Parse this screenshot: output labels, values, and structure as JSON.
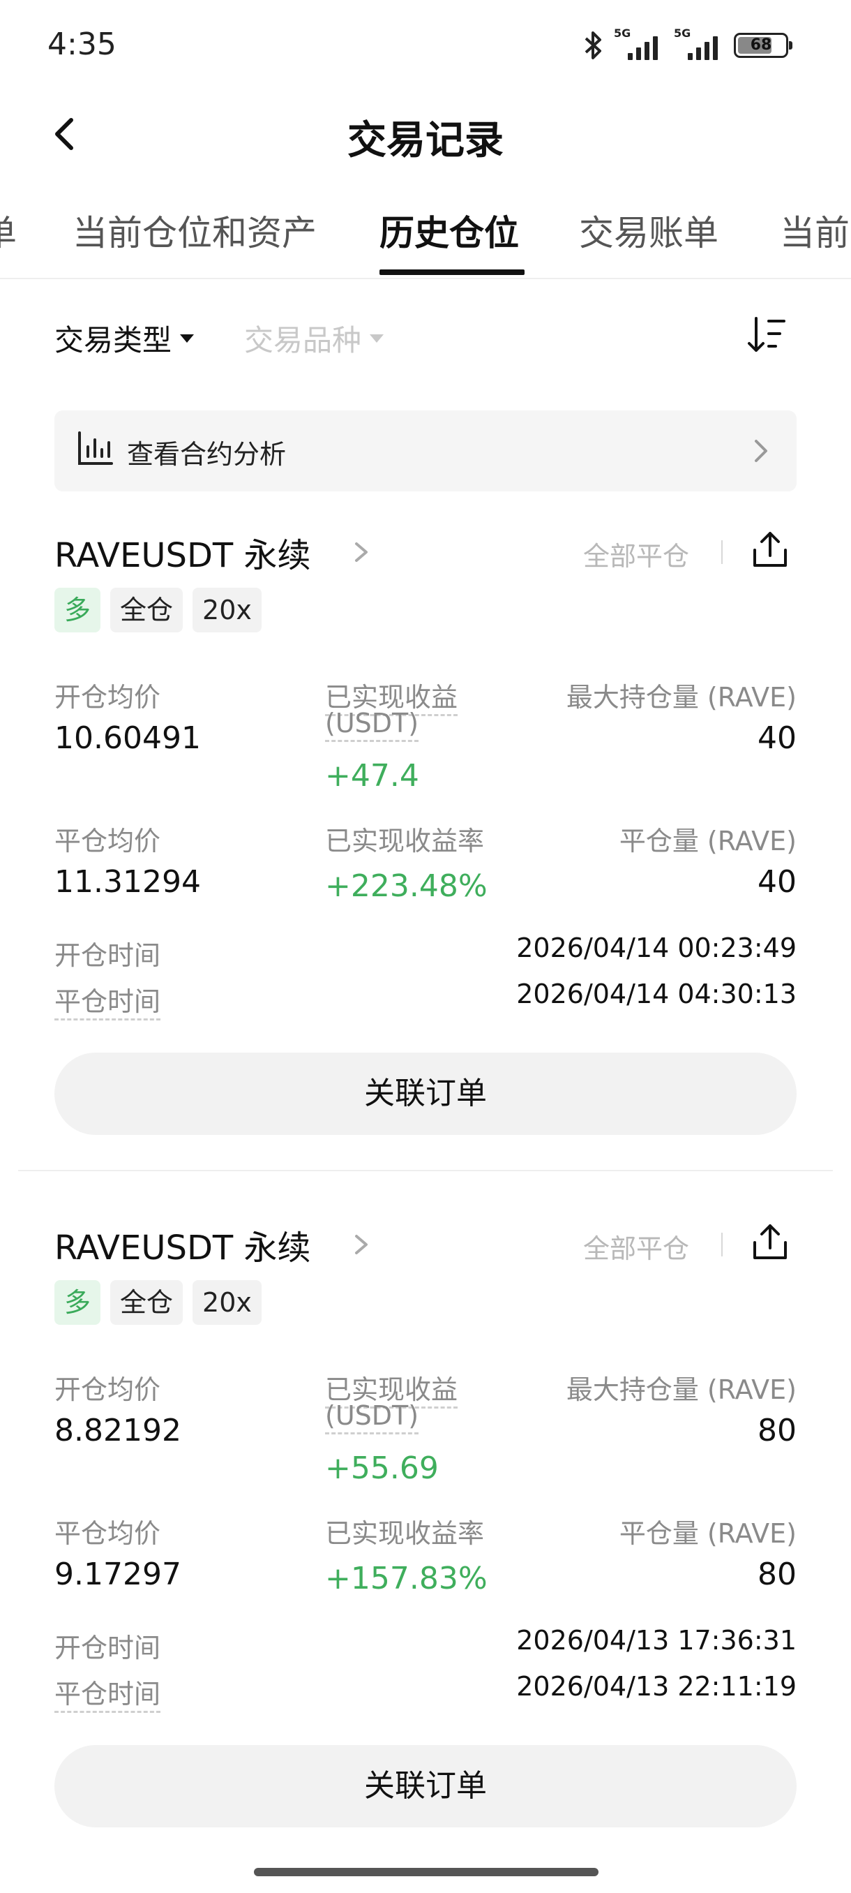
{
  "status": {
    "time": "4:35",
    "network1": "5G",
    "network2": "5G",
    "battery": "68"
  },
  "header": {
    "title": "交易记录"
  },
  "tabs": [
    {
      "label": "单"
    },
    {
      "label": "当前仓位和资产"
    },
    {
      "label": "历史仓位"
    },
    {
      "label": "交易账单"
    },
    {
      "label": "当前"
    }
  ],
  "filters": {
    "trade_type": "交易类型",
    "trade_symbol": "交易品种"
  },
  "analysis": {
    "label": "查看合约分析"
  },
  "labels": {
    "open_avg": "开仓均价",
    "realized_pnl": "已实现收益",
    "realized_pnl_unit": "(USDT)",
    "max_position": "最大持仓量 (RAVE)",
    "close_avg": "平仓均价",
    "realized_rate": "已实现收益率",
    "close_qty": "平仓量 (RAVE)",
    "open_time": "开仓时间",
    "close_time": "平仓时间",
    "close_all": "全部平仓",
    "linked_orders": "关联订单"
  },
  "positions": [
    {
      "symbol": "RAVEUSDT 永续",
      "side": "多",
      "margin": "全仓",
      "leverage": "20x",
      "open_avg": "10.60491",
      "realized_pnl": "+47.4",
      "max_position": "40",
      "close_avg": "11.31294",
      "realized_rate": "+223.48%",
      "close_qty": "40",
      "open_time": "2026/04/14 00:23:49",
      "close_time": "2026/04/14 04:30:13"
    },
    {
      "symbol": "RAVEUSDT 永续",
      "side": "多",
      "margin": "全仓",
      "leverage": "20x",
      "open_avg": "8.82192",
      "realized_pnl": "+55.69",
      "max_position": "80",
      "close_avg": "9.17297",
      "realized_rate": "+157.83%",
      "close_qty": "80",
      "open_time": "2026/04/13 17:36:31",
      "close_time": "2026/04/13 22:11:19"
    }
  ]
}
